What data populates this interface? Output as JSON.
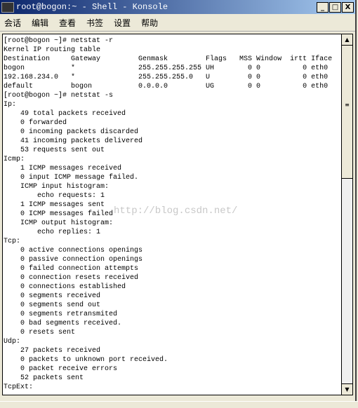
{
  "window": {
    "title": "root@bogon:~ - Shell - Konsole",
    "minimize": "_",
    "maximize": "□",
    "close": "X"
  },
  "menu": [
    "会话",
    "编辑",
    "查看",
    "书签",
    "设置",
    "帮助"
  ],
  "terminal": {
    "lines": [
      "[root@bogon ~]# netstat -r",
      "Kernel IP routing table",
      "Destination     Gateway         Genmask         Flags   MSS Window  irtt Iface",
      "bogon           *               255.255.255.255 UH        0 0          0 eth0",
      "192.168.234.0   *               255.255.255.0   U         0 0          0 eth0",
      "default         bogon           0.0.0.0         UG        0 0          0 eth0",
      "[root@bogon ~]# netstat -s",
      "Ip:",
      "    49 total packets received",
      "    0 forwarded",
      "    0 incoming packets discarded",
      "    41 incoming packets delivered",
      "    53 requests sent out",
      "Icmp:",
      "    1 ICMP messages received",
      "    0 input ICMP message failed.",
      "    ICMP input histogram:",
      "        echo requests: 1",
      "    1 ICMP messages sent",
      "    0 ICMP messages failed",
      "    ICMP output histogram:",
      "        echo replies: 1",
      "Tcp:",
      "    0 active connections openings",
      "    0 passive connection openings",
      "    0 failed connection attempts",
      "    0 connection resets received",
      "    0 connections established",
      "    0 segments received",
      "    0 segments send out",
      "    0 segments retransmited",
      "    0 bad segments received.",
      "    0 resets sent",
      "Udp:",
      "    27 packets received",
      "    0 packets to unknown port received.",
      "    0 packet receive errors",
      "    52 packets sent",
      "TcpExt:"
    ]
  },
  "watermark": "http://blog.csdn.net/",
  "scrollbar": {
    "up": "▲",
    "down": "▼",
    "grip": "≡"
  }
}
